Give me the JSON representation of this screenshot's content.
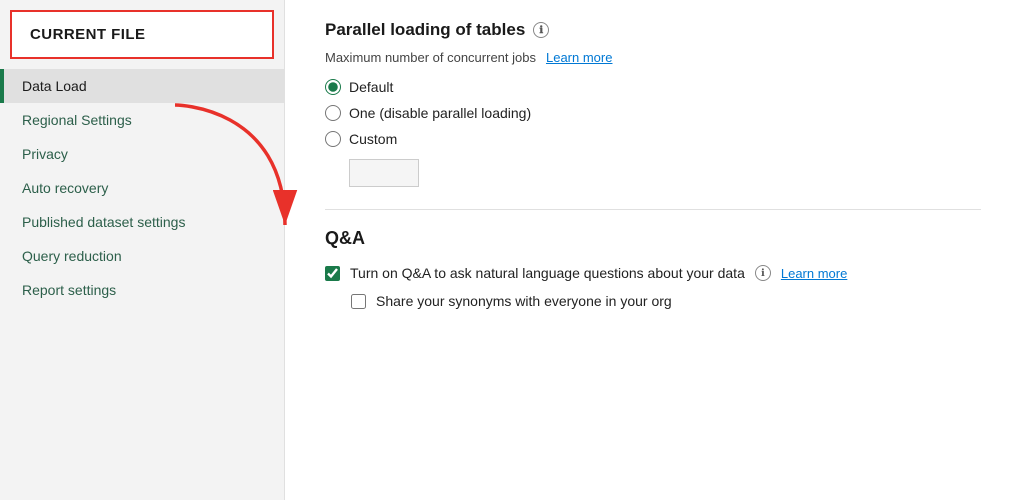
{
  "sidebar": {
    "header": "CURRENT FILE",
    "items": [
      {
        "id": "data-load",
        "label": "Data Load",
        "active": true
      },
      {
        "id": "regional-settings",
        "label": "Regional Settings",
        "active": false
      },
      {
        "id": "privacy",
        "label": "Privacy",
        "active": false
      },
      {
        "id": "auto-recovery",
        "label": "Auto recovery",
        "active": false
      },
      {
        "id": "published-dataset-settings",
        "label": "Published dataset settings",
        "active": false
      },
      {
        "id": "query-reduction",
        "label": "Query reduction",
        "active": false
      },
      {
        "id": "report-settings",
        "label": "Report settings",
        "active": false
      }
    ]
  },
  "main": {
    "parallel_loading_title": "Parallel loading of tables",
    "max_concurrent_label": "Maximum number of concurrent jobs",
    "learn_more_parallel": "Learn more",
    "radio_options": [
      {
        "id": "default",
        "label": "Default",
        "checked": true
      },
      {
        "id": "one",
        "label": "One (disable parallel loading)",
        "checked": false
      },
      {
        "id": "custom",
        "label": "Custom",
        "checked": false
      }
    ],
    "custom_input_value": "",
    "qa_section": {
      "title": "Q&A",
      "checkbox_qa_label": "Turn on Q&A to ask natural language questions about your data",
      "checkbox_qa_checked": true,
      "learn_more_qa": "Learn more",
      "checkbox_synonyms_label": "Share your synonyms with everyone in your org",
      "checkbox_synonyms_checked": false
    }
  },
  "icons": {
    "info": "ℹ"
  }
}
